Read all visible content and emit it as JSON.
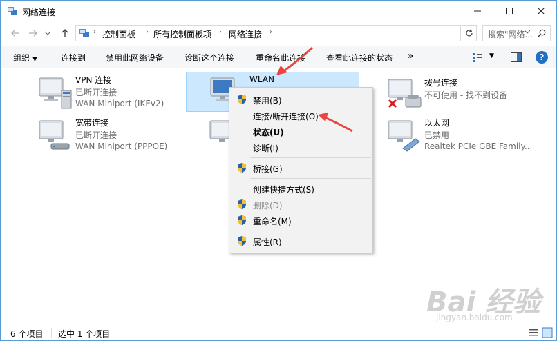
{
  "window": {
    "title": "网络连接"
  },
  "address": {
    "crumbs": [
      "控制面板",
      "所有控制面板项",
      "网络连接"
    ],
    "search_placeholder": "搜索\"网络..."
  },
  "toolbar": {
    "organize": "组织",
    "connect_to": "连接到",
    "disable_device": "禁用此网络设备",
    "diagnose": "诊断这个连接",
    "rename": "重命名此连接",
    "view_status": "查看此连接的状态",
    "more": "»"
  },
  "connections": [
    {
      "name": "VPN 连接",
      "status": "已断开连接",
      "device": "WAN Miniport (IKEv2)",
      "icon": "vpn-connection-icon"
    },
    {
      "name": "WLAN",
      "status": "",
      "device": "",
      "icon": "wlan-connection-icon",
      "selected": true
    },
    {
      "name": "拨号连接",
      "status": "不可使用 - 找不到设备",
      "device": "",
      "icon": "dialup-connection-icon"
    },
    {
      "name": "宽带连接",
      "status": "已断开连接",
      "device": "WAN Miniport (PPPOE)",
      "icon": "broadband-connection-icon"
    },
    {
      "name": "",
      "status": "",
      "device": "",
      "icon": "hidden-connection-icon"
    },
    {
      "name": "以太网",
      "status": "已禁用",
      "device": "Realtek PCIe GBE Family...",
      "icon": "ethernet-connection-icon"
    }
  ],
  "context_menu": {
    "items": [
      {
        "label": "禁用(B)",
        "shield": true
      },
      {
        "label": "连接/断开连接(O)",
        "shield": false
      },
      {
        "label": "状态(U)",
        "shield": false,
        "bold": true
      },
      {
        "label": "诊断(I)",
        "shield": false
      },
      {
        "label": "桥接(G)",
        "shield": true
      },
      {
        "label": "创建快捷方式(S)",
        "shield": false
      },
      {
        "label": "删除(D)",
        "shield": true,
        "disabled": true
      },
      {
        "label": "重命名(M)",
        "shield": true
      },
      {
        "label": "属性(R)",
        "shield": true
      }
    ]
  },
  "statusbar": {
    "item_count": "6 个项目",
    "selected_count": "选中 1 个项目"
  },
  "watermark": {
    "logo": "Bai 经验",
    "url": "jingyan.baidu.com"
  },
  "colors": {
    "accent": "#1f6fc4",
    "selection_bg": "#cce8ff",
    "arrow": "#e8473f"
  }
}
